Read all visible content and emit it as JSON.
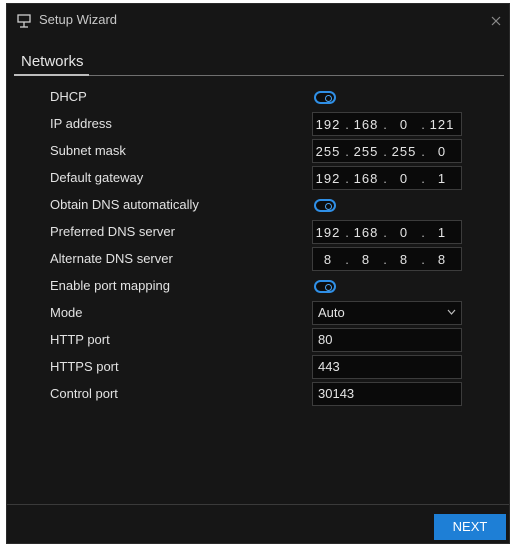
{
  "window": {
    "title": "Setup Wizard",
    "icon": "display-stand-icon",
    "close_icon": "close-icon"
  },
  "tab": {
    "label": "Networks"
  },
  "form": {
    "dhcp": {
      "label": "DHCP",
      "enabled": true
    },
    "ip_address": {
      "label": "IP address",
      "octets": [
        "192",
        "168",
        "0",
        "121"
      ]
    },
    "subnet_mask": {
      "label": "Subnet mask",
      "octets": [
        "255",
        "255",
        "255",
        "0"
      ]
    },
    "default_gateway": {
      "label": "Default gateway",
      "octets": [
        "192",
        "168",
        "0",
        "1"
      ]
    },
    "obtain_dns": {
      "label": "Obtain DNS automatically",
      "enabled": true
    },
    "preferred_dns": {
      "label": "Preferred DNS server",
      "octets": [
        "192",
        "168",
        "0",
        "1"
      ]
    },
    "alternate_dns": {
      "label": "Alternate DNS server",
      "octets": [
        "8",
        "8",
        "8",
        "8"
      ]
    },
    "port_mapping": {
      "label": "Enable port mapping",
      "enabled": true
    },
    "mode": {
      "label": "Mode",
      "value": "Auto"
    },
    "http_port": {
      "label": "HTTP port",
      "value": "80"
    },
    "https_port": {
      "label": "HTTPS port",
      "value": "443"
    },
    "control_port": {
      "label": "Control port",
      "value": "30143"
    }
  },
  "footer": {
    "next_label": "NEXT"
  },
  "colors": {
    "background": "#161616",
    "accent": "#1e7fd6",
    "toggle": "#2f8fe6",
    "text": "#e2e2e2"
  }
}
